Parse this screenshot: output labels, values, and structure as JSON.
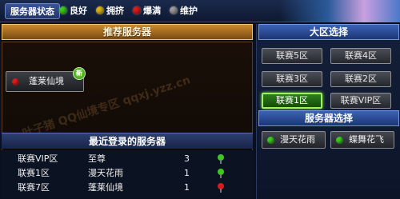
{
  "colors": {
    "good": "#3cc820",
    "busy": "#d8b21a",
    "full": "#d81c1c",
    "maintenance": "#9a9a9a"
  },
  "status_bar": {
    "title": "服务器状态",
    "legend": [
      {
        "label": "良好",
        "color": "#3cc820",
        "icon": "green-status-dot"
      },
      {
        "label": "拥挤",
        "color": "#d8b21a",
        "icon": "yellow-status-dot"
      },
      {
        "label": "爆满",
        "color": "#d81c1c",
        "icon": "red-status-dot"
      },
      {
        "label": "维护",
        "color": "#9a9a9a",
        "icon": "gray-status-dot"
      }
    ]
  },
  "recommended": {
    "header": "推荐服务器",
    "server": {
      "name": "蓬莱仙境",
      "status": "full",
      "badge": "新"
    }
  },
  "recent": {
    "header": "最近登录的服务器",
    "rows": [
      {
        "area": "联赛VIP区",
        "name": "至尊",
        "level": "3",
        "signal": "good"
      },
      {
        "area": "联赛1区",
        "name": "漫天花雨",
        "level": "1",
        "signal": "good"
      },
      {
        "area": "联赛7区",
        "name": "蓬莱仙境",
        "level": "1",
        "signal": "full"
      }
    ]
  },
  "regions": {
    "header": "大区选择",
    "buttons": [
      "联赛5区",
      "联赛4区",
      "联赛3区",
      "联赛2区",
      "联赛1区",
      "联赛VIP区"
    ],
    "active": "联赛1区"
  },
  "servers": {
    "header": "服务器选择",
    "items": [
      {
        "name": "漫天花雨",
        "status": "good"
      },
      {
        "name": "蝶舞花飞",
        "status": "good"
      }
    ]
  },
  "watermark": "叶子猪 QQ仙境专区 qqxj.yzz.cn"
}
